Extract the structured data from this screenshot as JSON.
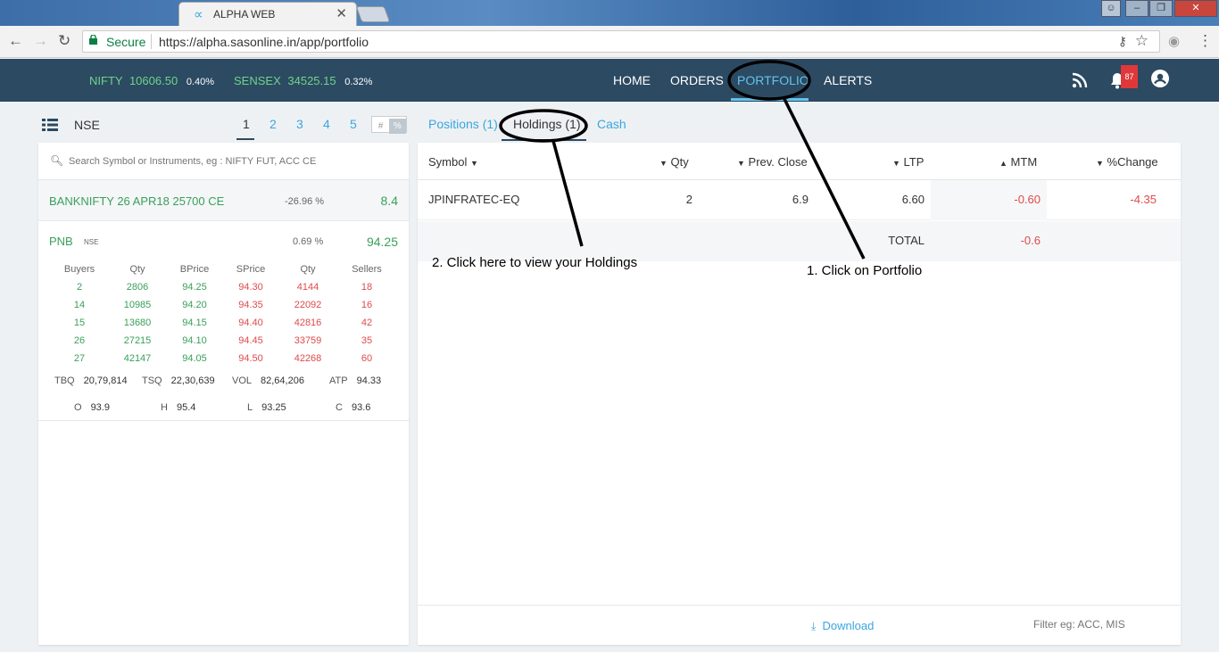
{
  "browser": {
    "tab_title": "ALPHA WEB",
    "tab_logo": "∝",
    "secure_label": "Secure",
    "url": "https://alpha.sasonline.in/app/portfolio"
  },
  "header": {
    "indices": [
      {
        "name": "NIFTY",
        "value": "10606.50",
        "change": "0.40%"
      },
      {
        "name": "SENSEX",
        "value": "34525.15",
        "change": "0.32%"
      }
    ],
    "menu": [
      "HOME",
      "ORDERS",
      "PORTFOLIO",
      "ALERTS"
    ],
    "active_menu": "PORTFOLIO",
    "notification_count": "87"
  },
  "watchlist": {
    "exchange": "NSE",
    "pages": [
      "1",
      "2",
      "3",
      "4",
      "5"
    ],
    "toggle": [
      "#",
      "%"
    ],
    "search_placeholder": "Search Symbol or Instruments, eg : NIFTY FUT, ACC CE",
    "items": [
      {
        "symbol": "BANKNIFTY 26 APR18 25700 CE",
        "change": "-26.96 %",
        "ltp": "8.4"
      },
      {
        "symbol": "PNB",
        "exchange": "NSE",
        "change": "0.69 %",
        "ltp": "94.25"
      }
    ],
    "depth": {
      "headers": [
        "Buyers",
        "Qty",
        "BPrice",
        "SPrice",
        "Qty",
        "Sellers"
      ],
      "rows": [
        [
          "2",
          "2806",
          "94.25",
          "94.30",
          "4144",
          "18"
        ],
        [
          "14",
          "10985",
          "94.20",
          "94.35",
          "22092",
          "16"
        ],
        [
          "15",
          "13680",
          "94.15",
          "94.40",
          "42816",
          "42"
        ],
        [
          "26",
          "27215",
          "94.10",
          "94.45",
          "33759",
          "35"
        ],
        [
          "27",
          "42147",
          "94.05",
          "94.50",
          "42268",
          "60"
        ]
      ],
      "stats": [
        {
          "label": "TBQ",
          "value": "20,79,814"
        },
        {
          "label": "TSQ",
          "value": "22,30,639"
        },
        {
          "label": "VOL",
          "value": "82,64,206"
        },
        {
          "label": "ATP",
          "value": "94.33"
        }
      ],
      "ohlc": [
        {
          "label": "O",
          "value": "93.9"
        },
        {
          "label": "H",
          "value": "95.4"
        },
        {
          "label": "L",
          "value": "93.25"
        },
        {
          "label": "C",
          "value": "93.6"
        }
      ]
    }
  },
  "portfolio": {
    "tabs": [
      "Positions (1)",
      "Holdings (1)",
      "Cash"
    ],
    "active_tab": "Holdings (1)",
    "columns": [
      "Symbol",
      "Qty",
      "Prev. Close",
      "LTP",
      "MTM",
      "%Change"
    ],
    "rows": [
      {
        "symbol": "JPINFRATEC-EQ",
        "qty": "2",
        "prev_close": "6.9",
        "ltp": "6.60",
        "mtm": "-0.60",
        "pct_change": "-4.35"
      }
    ],
    "total_label": "TOTAL",
    "total_mtm": "-0.6",
    "download_label": "Download",
    "filter_placeholder": "Filter eg: ACC, MIS"
  },
  "annotations": {
    "step1": "1. Click on Portfolio",
    "step2": "2. Click here to view your Holdings"
  },
  "colors": {
    "header_bg": "#2c4a62",
    "accent": "#3aa6e0",
    "positive": "#3aa05a",
    "negative": "#e04a4a"
  }
}
